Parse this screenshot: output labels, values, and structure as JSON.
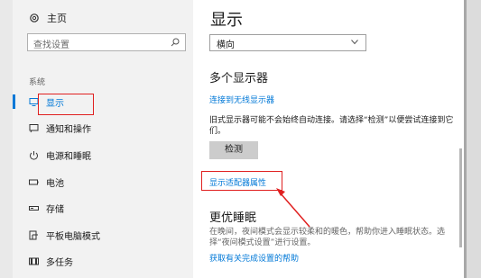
{
  "sidebar": {
    "home_label": "主页",
    "search_placeholder": "查找设置",
    "section_label": "系统",
    "items": [
      {
        "label": "显示",
        "icon": "monitor-icon",
        "active": true
      },
      {
        "label": "通知和操作",
        "icon": "notification-icon"
      },
      {
        "label": "电源和睡眠",
        "icon": "power-icon"
      },
      {
        "label": "电池",
        "icon": "battery-icon"
      },
      {
        "label": "存储",
        "icon": "storage-icon"
      },
      {
        "label": "平板电脑模式",
        "icon": "tablet-mode-icon"
      },
      {
        "label": "多任务",
        "icon": "multitasking-icon"
      }
    ]
  },
  "main": {
    "title": "显示",
    "orientation_value": "横向",
    "multi_display_heading": "多个显示器",
    "connect_wireless_link": "连接到无线显示器",
    "detect_description": "旧式显示器可能不会始终自动连接。请选择“检测”以便尝试连接到它们。",
    "detect_button": "检测",
    "adapter_properties_link": "显示适配器属性",
    "sleep_heading": "更优睡眠",
    "sleep_description": "在晚间，夜间模式会显示较柔和的暖色，帮助你进入睡眠状态。选择“夜间模式设置”进行设置。",
    "sleep_help_link": "获取有关完成设置的帮助"
  },
  "colors": {
    "accent": "#0078d7",
    "highlight": "#e02020",
    "sidebar_bg": "#f2f2f2"
  }
}
